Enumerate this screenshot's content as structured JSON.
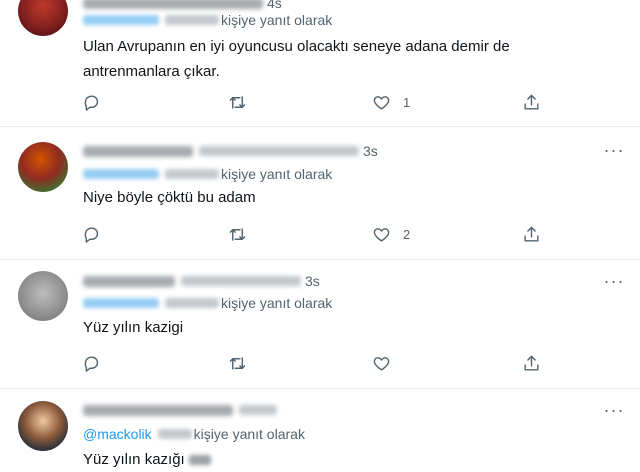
{
  "replying_suffix": "kişiye yanıt olarak",
  "tweets": [
    {
      "time": "4s",
      "mention": "",
      "text": "Ulan Avrupanın en iyi oyuncusu olacaktı seneye adana demir de antrenmanlara çıkar.",
      "likes": "1",
      "replies": "",
      "retweets": ""
    },
    {
      "time": "3s",
      "mention": "",
      "text": "Niye böyle çöktü bu adam",
      "likes": "2",
      "replies": "",
      "retweets": ""
    },
    {
      "time": "3s",
      "mention": "",
      "text": "Yüz yılın kazigi",
      "likes": "",
      "replies": "",
      "retweets": ""
    },
    {
      "time": "",
      "mention": "@mackolik",
      "text": "Yüz yılın kazığı",
      "likes": "",
      "replies": "",
      "retweets": ""
    }
  ],
  "icons": {
    "reply": "reply-icon",
    "retweet": "retweet-icon",
    "like": "heart-icon",
    "share": "share-icon",
    "more": "more-options-icon"
  },
  "colors": {
    "link": "#1d9bf0",
    "secondary_text": "#536471",
    "divider": "#e6ecf0"
  }
}
